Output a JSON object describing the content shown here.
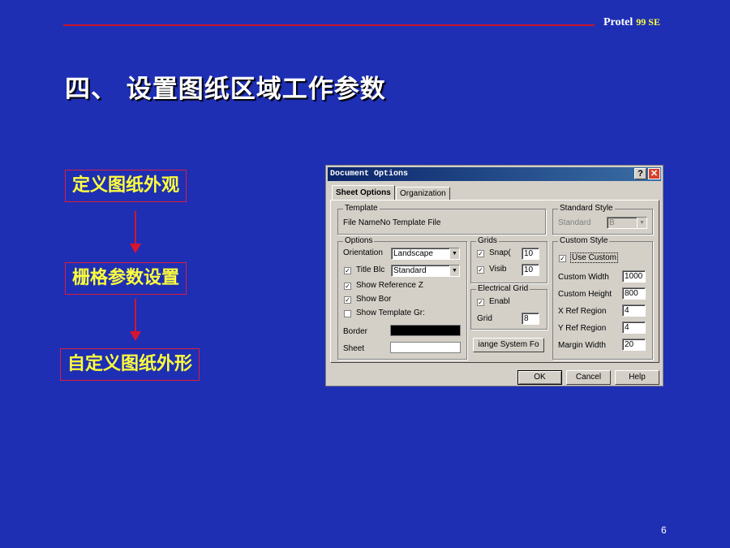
{
  "header": {
    "brand": "Protel",
    "version": "99 SE"
  },
  "slide": {
    "title": "四、 设置图纸区域工作参数",
    "page_number": "6"
  },
  "flow": {
    "step1": "定义图纸外观",
    "step2": "栅格参数设置",
    "step3": "自定义图纸外形"
  },
  "colors": {
    "background": "#1e2fb4",
    "accent_red": "#c8142c",
    "highlight_yellow": "#ffff3c"
  },
  "dialog": {
    "title": "Document Options",
    "tabs": [
      "Sheet Options",
      "Organization"
    ],
    "template": {
      "label": "Template",
      "file_label": "File Name",
      "file_value": "No Template File"
    },
    "standard_style": {
      "label": "Standard Style",
      "field_label": "Standard",
      "value": "B"
    },
    "options": {
      "label": "Options",
      "orientation_label": "Orientation",
      "orientation_value": "Landscape",
      "title_block_label": "Title Blc",
      "title_block_value": "Standard",
      "show_reference_label": "Show Reference Z",
      "show_border_label": "Show Bor",
      "show_template_label": "Show Template Gr:",
      "border_label": "Border",
      "sheet_label": "Sheet"
    },
    "grids": {
      "label": "Grids",
      "snap_label": "Snap(",
      "snap_value": "10",
      "visible_label": "Visib",
      "visible_value": "10"
    },
    "electrical_grid": {
      "label": "Electrical Grid",
      "enable_label": "Enabl",
      "grid_label": "Grid",
      "grid_value": "8"
    },
    "change_font_label": "iange System Fo",
    "custom_style": {
      "label": "Custom Style",
      "use_custom_label": "Use Custom",
      "custom_width_label": "Custom Width",
      "custom_width_value": "1000",
      "custom_height_label": "Custom Height",
      "custom_height_value": "800",
      "x_ref_label": "X Ref Region",
      "x_ref_value": "4",
      "y_ref_label": "Y Ref Region",
      "y_ref_value": "4",
      "margin_label": "Margin Width",
      "margin_value": "20"
    },
    "buttons": {
      "ok": "OK",
      "cancel": "Cancel",
      "help": "Help"
    },
    "help_icon_label": "?",
    "close_icon_label": "✕",
    "check_mark": "✓",
    "dropdown_glyph": "▼",
    "border_color": "#000000",
    "sheet_color": "#ffffff"
  }
}
